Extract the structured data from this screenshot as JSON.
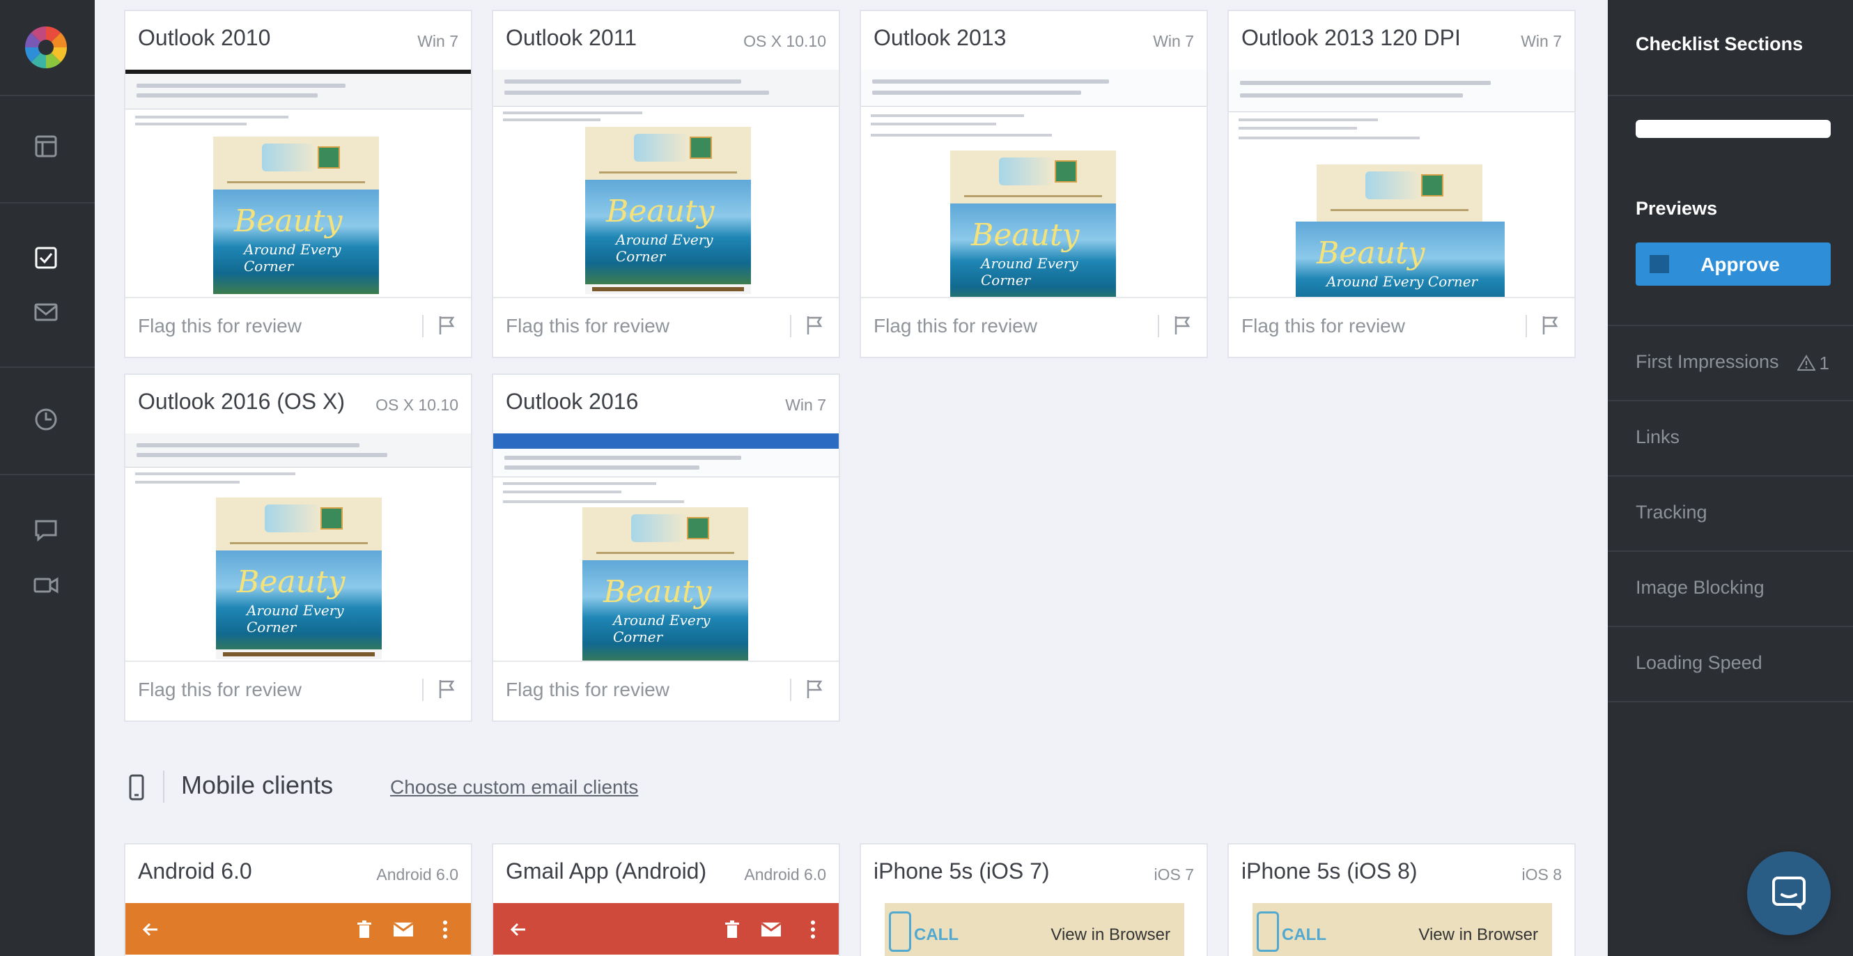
{
  "colors": {
    "rail_bg": "#2b2e33",
    "accent_blue": "#2e8fd8",
    "android_orange": "#e07b2a",
    "gmail_red": "#d04a3c"
  },
  "nav_icons": [
    "logo-color-wheel",
    "layout-icon",
    "checklist-icon",
    "mail-icon",
    "clock-icon",
    "chat-icon",
    "video-icon"
  ],
  "desktop_cards": [
    {
      "title": "Outlook 2010",
      "os": "Win 7",
      "flag": "Flag this for review"
    },
    {
      "title": "Outlook 2011",
      "os": "OS X 10.10",
      "flag": "Flag this for review"
    },
    {
      "title": "Outlook 2013",
      "os": "Win 7",
      "flag": "Flag this for review"
    },
    {
      "title": "Outlook 2013 120 DPI",
      "os": "Win 7",
      "flag": "Flag this for review"
    },
    {
      "title": "Outlook 2016 (OS X)",
      "os": "OS X 10.10",
      "flag": "Flag this for review"
    },
    {
      "title": "Outlook 2016",
      "os": "Win 7",
      "flag": "Flag this for review"
    }
  ],
  "mobile_section": {
    "title": "Mobile clients",
    "link": "Choose custom email clients"
  },
  "mobile_cards": [
    {
      "title": "Android 6.0",
      "os": "Android 6.0"
    },
    {
      "title": "Gmail App (Android)",
      "os": "Android 6.0"
    },
    {
      "title": "iPhone 5s (iOS 7)",
      "os": "iOS 7",
      "call": "CALL",
      "view_browser": "View in Browser"
    },
    {
      "title": "iPhone 5s (iOS 8)",
      "os": "iOS 8",
      "call": "CALL",
      "view_browser": "View in Browser"
    }
  ],
  "email_preview": {
    "script_title": "Beauty",
    "script_sub": "Around Every Corner"
  },
  "sidebar": {
    "heading": "Checklist Sections",
    "progress": 1.0,
    "previews_label": "Previews",
    "approve_label": "Approve",
    "items": [
      {
        "label": "First Impressions",
        "warnings": "1"
      },
      {
        "label": "Links"
      },
      {
        "label": "Tracking"
      },
      {
        "label": "Image Blocking"
      },
      {
        "label": "Loading Speed"
      }
    ]
  }
}
